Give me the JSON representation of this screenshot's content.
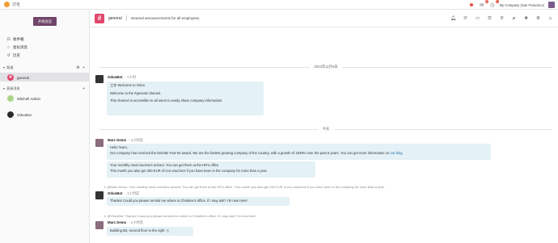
{
  "topbar": {
    "app_title": "讨论",
    "badges": [
      "4",
      "1"
    ],
    "company": "My Company (San Francisco)"
  },
  "sidebar": {
    "start_button": "开始会议",
    "items": [
      {
        "label": "收件箱",
        "icon": "inbox-icon"
      },
      {
        "label": "星标消息",
        "icon": "star-icon"
      },
      {
        "label": "历史",
        "icon": "history-icon"
      }
    ],
    "channels_header": "频道",
    "channels_actions": "⚙ +",
    "channels": [
      {
        "label": "general",
        "icon_char": "#"
      }
    ],
    "dm_header": "直接消息",
    "dm_actions": "+",
    "direct_messages": [
      {
        "label": "Mitchell Admin"
      },
      {
        "label": "OdooBot"
      }
    ]
  },
  "header": {
    "icon_char": "#",
    "channel_name": "general",
    "description": "General announcements for all employees."
  },
  "messages": {
    "date_1": "2023年11月8日",
    "date_2": "今天",
    "m1_sender": "OdooBot",
    "m1_time": "- 7小时",
    "m1_lines": [
      "工作 Welcome to Odoo",
      "Welcome to the #general channel.",
      "This channel is accessible to all users to easily share company information."
    ],
    "m2_sender": "Marc Demo",
    "m2_time": "- 1小时前",
    "m2_lines": [
      "Hello Team,",
      "Our company has received the Deloitte Fast 50 award. We are the fastest growing company of the country, with a growth of 1549% over the past 5 years. You can get more information on",
      "our blog",
      "Your monthly meal vouchers arrived. You can get them at the HR's office.",
      "This month you also get 250 EUR of eco-vouchers if you have been in the company for more than a year."
    ],
    "m3_reply": "@Marc Demo: Your monthly meal vouchers arrived. You can get them at the HR's office. This month you also get 250 EUR of eco-vouchers if you have been in the company for more than a year.",
    "m3_sender": "OdooBot",
    "m3_time": "- 1小时前",
    "m3_lines": [
      "Thanks! Could you please remind me where is Christine's office, if I may ask? I'm new here!"
    ],
    "m4_reply": "@OdooBot: Thanks! Could you please remind me where is Christine's office, if I may ask? I'm new here!",
    "m4_sender": "Marc Demo",
    "m4_time": "- 1小时前",
    "m4_lines": [
      "Building B3, second floor to the right :-)."
    ]
  },
  "colors": {
    "accent": "#71456a",
    "channel": "#e0476d",
    "bubble": "#e4f1f6"
  }
}
